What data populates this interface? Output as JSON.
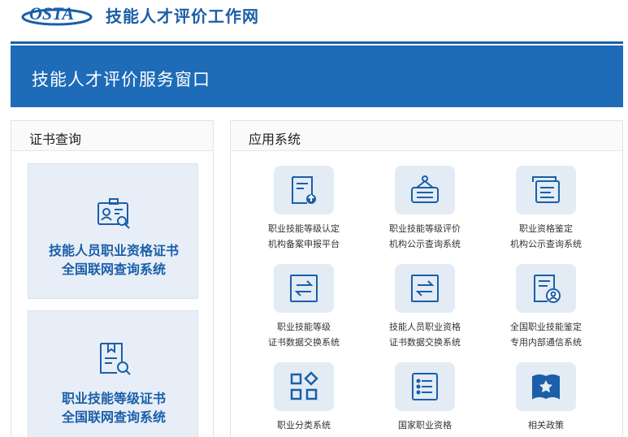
{
  "header": {
    "logo_text": "OSTA",
    "site_title": "技能人才评价工作网"
  },
  "banner": {
    "title": "技能人才评价服务窗口"
  },
  "cert_panel": {
    "title": "证书查询",
    "cards": [
      {
        "line1": "技能人员职业资格证书",
        "line2": "全国联网查询系统",
        "icon": "certificate-search-icon"
      },
      {
        "line1": "职业技能等级证书",
        "line2": "全国联网查询系统",
        "icon": "document-search-icon"
      }
    ]
  },
  "apps_panel": {
    "title": "应用系统",
    "items": [
      {
        "line1": "职业技能等级认定",
        "line2": "机构备案申报平台",
        "icon": "document-upload-icon"
      },
      {
        "line1": "职业技能等级评价",
        "line2": "机构公示查询系统",
        "icon": "notice-board-icon"
      },
      {
        "line1": "职业资格鉴定",
        "line2": "机构公示查询系统",
        "icon": "stacked-documents-icon"
      },
      {
        "line1": "职业技能等级",
        "line2": "证书数据交换系统",
        "icon": "exchange-icon"
      },
      {
        "line1": "技能人员职业资格",
        "line2": "证书数据交换系统",
        "icon": "exchange-icon"
      },
      {
        "line1": "全国职业技能鉴定",
        "line2": "专用内部通信系统",
        "icon": "user-document-icon"
      },
      {
        "line1": "职业分类系统",
        "line2": "",
        "icon": "grid-diamond-icon"
      },
      {
        "line1": "国家职业资格",
        "line2": "",
        "icon": "list-icon"
      },
      {
        "line1": "相关政策",
        "line2": "",
        "icon": "star-book-icon"
      }
    ]
  },
  "colors": {
    "brand_blue": "#1a5fa8",
    "banner_blue": "#1e6bb8",
    "card_bg": "#e8eef7",
    "icon_bg": "#e3ebf5"
  }
}
